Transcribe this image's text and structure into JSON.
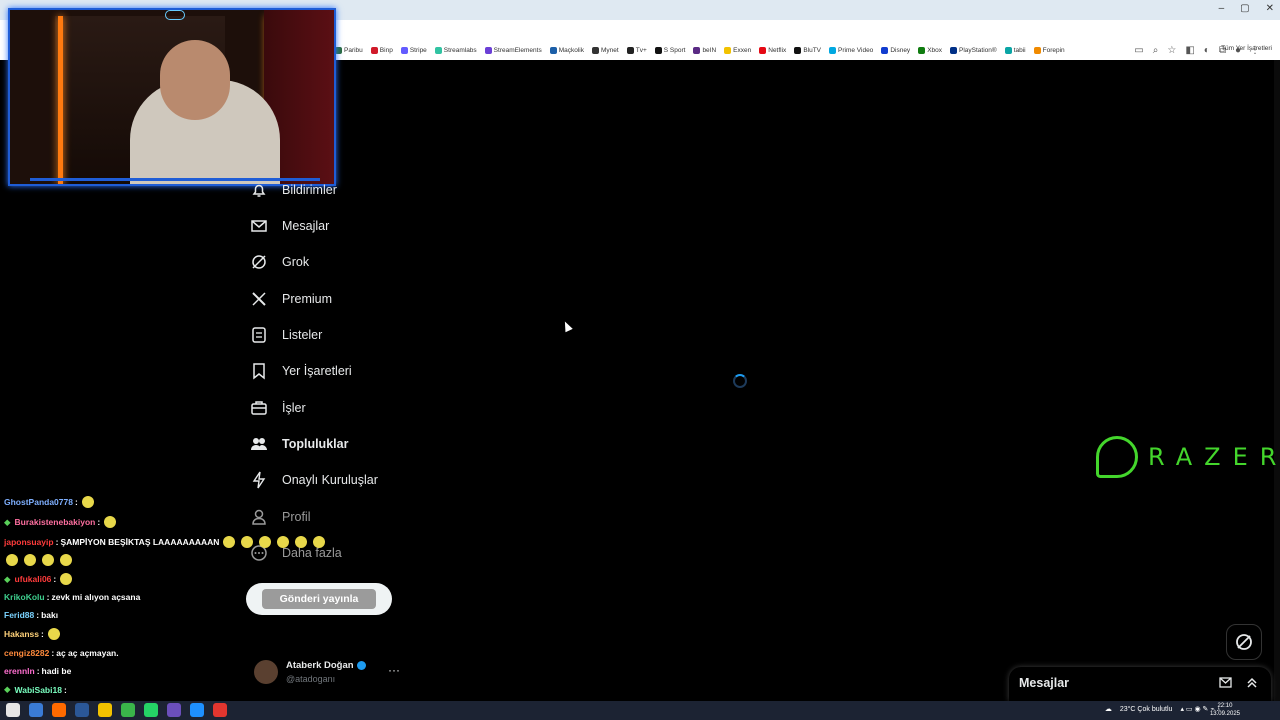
{
  "browser": {
    "window_controls": [
      "–",
      "▢",
      "✕"
    ],
    "bookmarks": [
      {
        "label": "Paribu",
        "color": "#2a6b3c"
      },
      {
        "label": "Binp",
        "color": "#d01a2a"
      },
      {
        "label": "Stripe",
        "color": "#635bff"
      },
      {
        "label": "Streamlabs",
        "color": "#31c3a2"
      },
      {
        "label": "StreamElements",
        "color": "#6b3fd6"
      },
      {
        "label": "Maçkolik",
        "color": "#1c5fa8"
      },
      {
        "label": "Mynet",
        "color": "#333333"
      },
      {
        "label": "Tv+",
        "color": "#222222"
      },
      {
        "label": "S Sport",
        "color": "#111111"
      },
      {
        "label": "beIN",
        "color": "#5a2a84"
      },
      {
        "label": "Exxen",
        "color": "#f2c200"
      },
      {
        "label": "Netflix",
        "color": "#e50914"
      },
      {
        "label": "BluTV",
        "color": "#111111"
      },
      {
        "label": "Prime Video",
        "color": "#00a8e1"
      },
      {
        "label": "Disney",
        "color": "#113ccf"
      },
      {
        "label": "Xbox",
        "color": "#107c10"
      },
      {
        "label": "PlayStation®",
        "color": "#003087"
      },
      {
        "label": "tabii",
        "color": "#0aa5a5"
      },
      {
        "label": "Forepin",
        "color": "#f08a00"
      }
    ],
    "all_bookmarks": "Tüm Yer İşaretleri"
  },
  "nav": {
    "items": [
      {
        "label": "Bildirimler",
        "icon": "bell-icon",
        "style": "normal"
      },
      {
        "label": "Mesajlar",
        "icon": "mail-icon",
        "style": "normal"
      },
      {
        "label": "Grok",
        "icon": "grok-icon",
        "style": "normal"
      },
      {
        "label": "Premium",
        "icon": "x-logo-icon",
        "style": "normal"
      },
      {
        "label": "Listeler",
        "icon": "list-icon",
        "style": "normal"
      },
      {
        "label": "Yer İşaretleri",
        "icon": "bookmark-icon",
        "style": "normal"
      },
      {
        "label": "İşler",
        "icon": "briefcase-icon",
        "style": "normal"
      },
      {
        "label": "Topluluklar",
        "icon": "people-icon",
        "style": "bold"
      },
      {
        "label": "Onaylı Kuruluşlar",
        "icon": "lightning-icon",
        "style": "normal"
      },
      {
        "label": "Profil",
        "icon": "person-icon",
        "style": "dim"
      },
      {
        "label": "Daha fazla",
        "icon": "more-circle-icon",
        "style": "dim"
      }
    ],
    "post_button": "Gönderi yayınla"
  },
  "profile": {
    "name": "Ataberk Doğan",
    "handle": "@atadoganı",
    "more": "···"
  },
  "chat": [
    {
      "user": "GhostPanda0778",
      "color": "#7fb0ff",
      "text": "",
      "emotes": 1,
      "gem": false
    },
    {
      "user": "Burakistenebakiyon",
      "color": "#ff6fa0",
      "text": "",
      "emotes": 1,
      "gem": true
    },
    {
      "user": "japonsuayip",
      "color": "#ff3b3b",
      "text": "ŞAMPİYON BEŞİKTAŞ LAAAAAAAAAN",
      "emotes": 6,
      "gem": false
    },
    {
      "user": "",
      "color": "#ffffff",
      "text": "",
      "emotes": 4,
      "gem": false
    },
    {
      "user": "ufukali06",
      "color": "#ff3b3b",
      "text": "",
      "emotes": 1,
      "gem": true
    },
    {
      "user": "KrikoKolu",
      "color": "#3ecf8e",
      "text": "zevk mi alıyon açsana",
      "emotes": 0,
      "gem": false
    },
    {
      "user": "Ferid88",
      "color": "#7ad3ff",
      "text": "bakı",
      "emotes": 0,
      "gem": false
    },
    {
      "user": "Hakanss",
      "color": "#ffd27a",
      "text": "",
      "emotes": 1,
      "gem": false
    },
    {
      "user": "cengiz8282",
      "color": "#ff8a3c",
      "text": "aç aç açmayan.",
      "emotes": 0,
      "gem": false
    },
    {
      "user": "erennln",
      "color": "#ff6fd0",
      "text": "hadi be",
      "emotes": 0,
      "gem": false
    },
    {
      "user": "WabiSabi18",
      "color": "#7affc0",
      "text": "",
      "emotes": 0,
      "gem": true
    }
  ],
  "messages_drawer": {
    "title": "Mesajlar"
  },
  "razer": {
    "text": "RAZER"
  },
  "taskbar": {
    "weather": "23°C Çok bulutlu",
    "time": "22:10",
    "date": "13.09.2025",
    "apps": [
      "#3a7bd5",
      "#ff6a00",
      "#2b5797",
      "#f2c200",
      "#3ab54a",
      "#25d366",
      "#6b4fbb",
      "#1e90ff",
      "#e2362f"
    ]
  },
  "colors": {
    "accent": "#1d9bf0",
    "razer_green": "#44d62c",
    "webcam_border": "#1f5dd6"
  }
}
